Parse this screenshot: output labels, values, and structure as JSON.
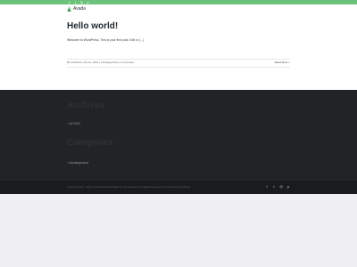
{
  "top_bar": {
    "social": [
      {
        "icon": "facebook-icon",
        "glyph": "f"
      },
      {
        "icon": "twitter-icon",
        "glyph": "t"
      },
      {
        "icon": "instagram-icon",
        "glyph": "◎"
      },
      {
        "icon": "pinterest-icon",
        "glyph": "p"
      }
    ]
  },
  "header": {
    "logo_text": "Avada"
  },
  "post": {
    "title": "Hello world!",
    "excerpt": "Welcome to WordPress. This is your first post. Edit or [...]",
    "meta": "By host10t4 | Jul 1st, 2022 | Uncategorized | 1 Comment",
    "read_more": "Read More >"
  },
  "footer_widgets": {
    "archives_title": "Archives",
    "archive_link": "› Jul 2022",
    "categories_title": "Categories",
    "category_link": "› Uncategorized"
  },
  "footer": {
    "copyright": "Copyright 2012 - 2022 | Avada Website Builder by ThemeFusion | All Rights Reserved | Powered by WordPress",
    "social": [
      {
        "icon": "facebook-icon",
        "glyph": "f"
      },
      {
        "icon": "twitter-icon",
        "glyph": "t"
      },
      {
        "icon": "instagram-icon",
        "glyph": "◎"
      },
      {
        "icon": "pinterest-icon",
        "glyph": "p"
      }
    ]
  },
  "colors": {
    "accent_green": "#6cc27a",
    "footer_dark": "#222326",
    "copyright_dark": "#1a1b1d"
  }
}
